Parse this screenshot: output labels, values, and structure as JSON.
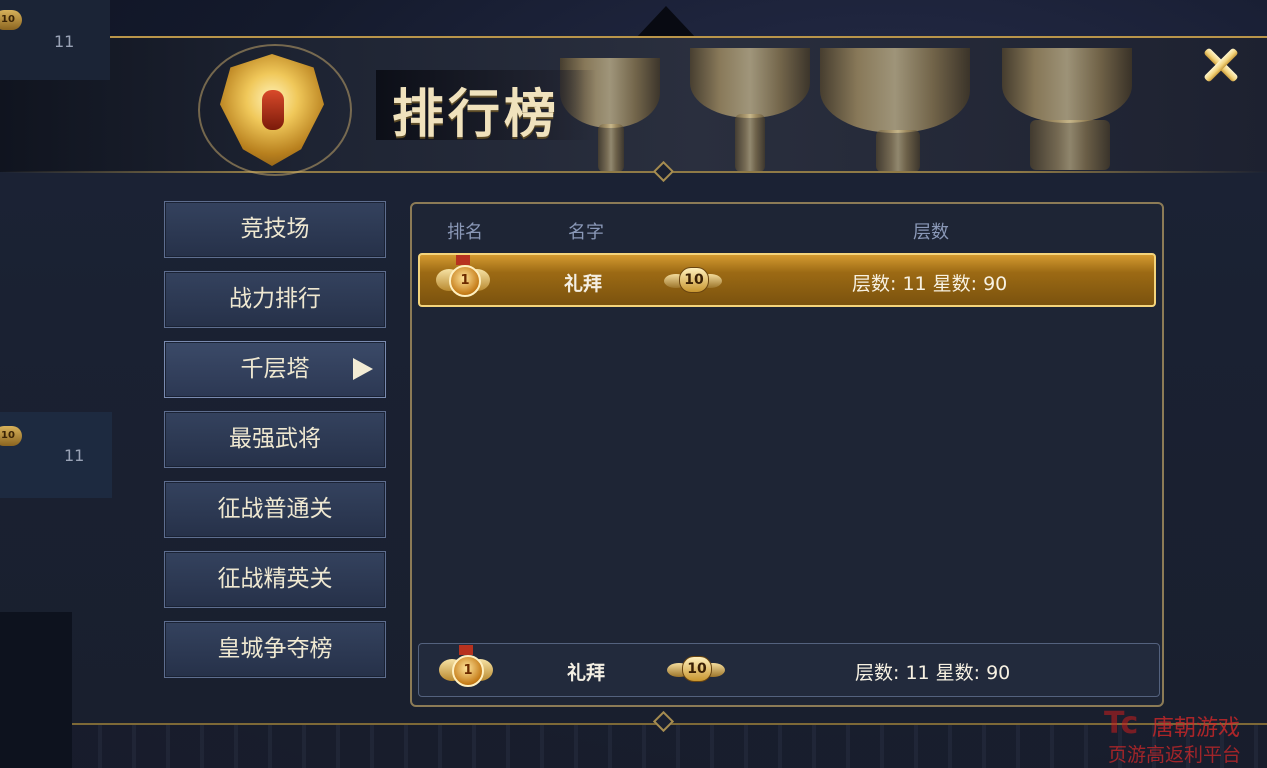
{
  "window": {
    "title": "排行榜"
  },
  "background": {
    "left_value_top": "11",
    "left_value_mid": "11",
    "badge_label": "10"
  },
  "tabs": [
    {
      "label": "竞技场"
    },
    {
      "label": "战力排行"
    },
    {
      "label": "千层塔",
      "active": true
    },
    {
      "label": "最强武将"
    },
    {
      "label": "征战普通关"
    },
    {
      "label": "征战精英关"
    },
    {
      "label": "皇城争夺榜"
    }
  ],
  "table": {
    "headers": {
      "rank": "排名",
      "name": "名字",
      "floor": "层数"
    },
    "rows": [
      {
        "rank": "1",
        "name": "礼拜",
        "level_badge": "10",
        "score_text": "层数: 11  星数: 90"
      }
    ],
    "self_row": {
      "rank": "1",
      "name": "礼拜",
      "level_badge": "10",
      "score_text": "层数: 11  星数: 90"
    }
  },
  "watermark": {
    "logo": "Tc",
    "line1": "唐朝游戏",
    "line2": "页游高返利平台"
  },
  "colors": {
    "gold": "#d49a30",
    "panel": "#1e2535",
    "tab": "#2c3853",
    "close": "#f2d27a",
    "watermark": "#dc2828"
  },
  "icons": {
    "close": "close-icon",
    "tab_arrow": "play-arrow-icon",
    "rank_medal": "rank-medal-icon",
    "level_badge": "winged-level-badge-icon",
    "emblem": "golden-mask-emblem-icon"
  }
}
